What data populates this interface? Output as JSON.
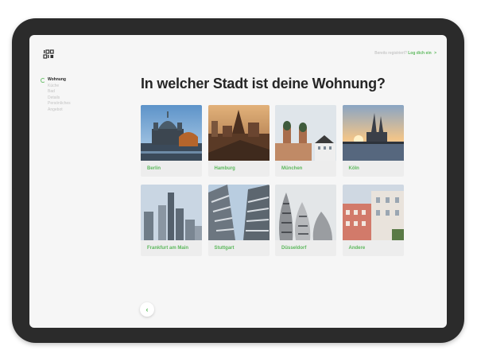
{
  "header": {
    "logo_icon": "brand-logo-icon",
    "login_prompt": "Bereits registriert?",
    "login_link": "Log dich ein",
    "login_chevron": ">"
  },
  "steps": [
    {
      "label": "Wohnung",
      "active": true
    },
    {
      "label": "Küche",
      "active": false
    },
    {
      "label": "Bad",
      "active": false
    },
    {
      "label": "Details",
      "active": false
    },
    {
      "label": "Persönliches",
      "active": false
    },
    {
      "label": "Angebot",
      "active": false
    }
  ],
  "main": {
    "title": "In welcher Stadt ist deine Wohnung?",
    "cities": [
      {
        "label": "Berlin"
      },
      {
        "label": "Hamburg"
      },
      {
        "label": "München"
      },
      {
        "label": "Köln"
      },
      {
        "label": "Frankfurt am Main"
      },
      {
        "label": "Stuttgart"
      },
      {
        "label": "Düsseldorf"
      },
      {
        "label": "Andere"
      }
    ]
  },
  "footer": {
    "back_label": "‹"
  },
  "colors": {
    "accent": "#5cb85c",
    "device": "#2b2b2b",
    "screen": "#f6f6f6",
    "card": "#ededed"
  }
}
